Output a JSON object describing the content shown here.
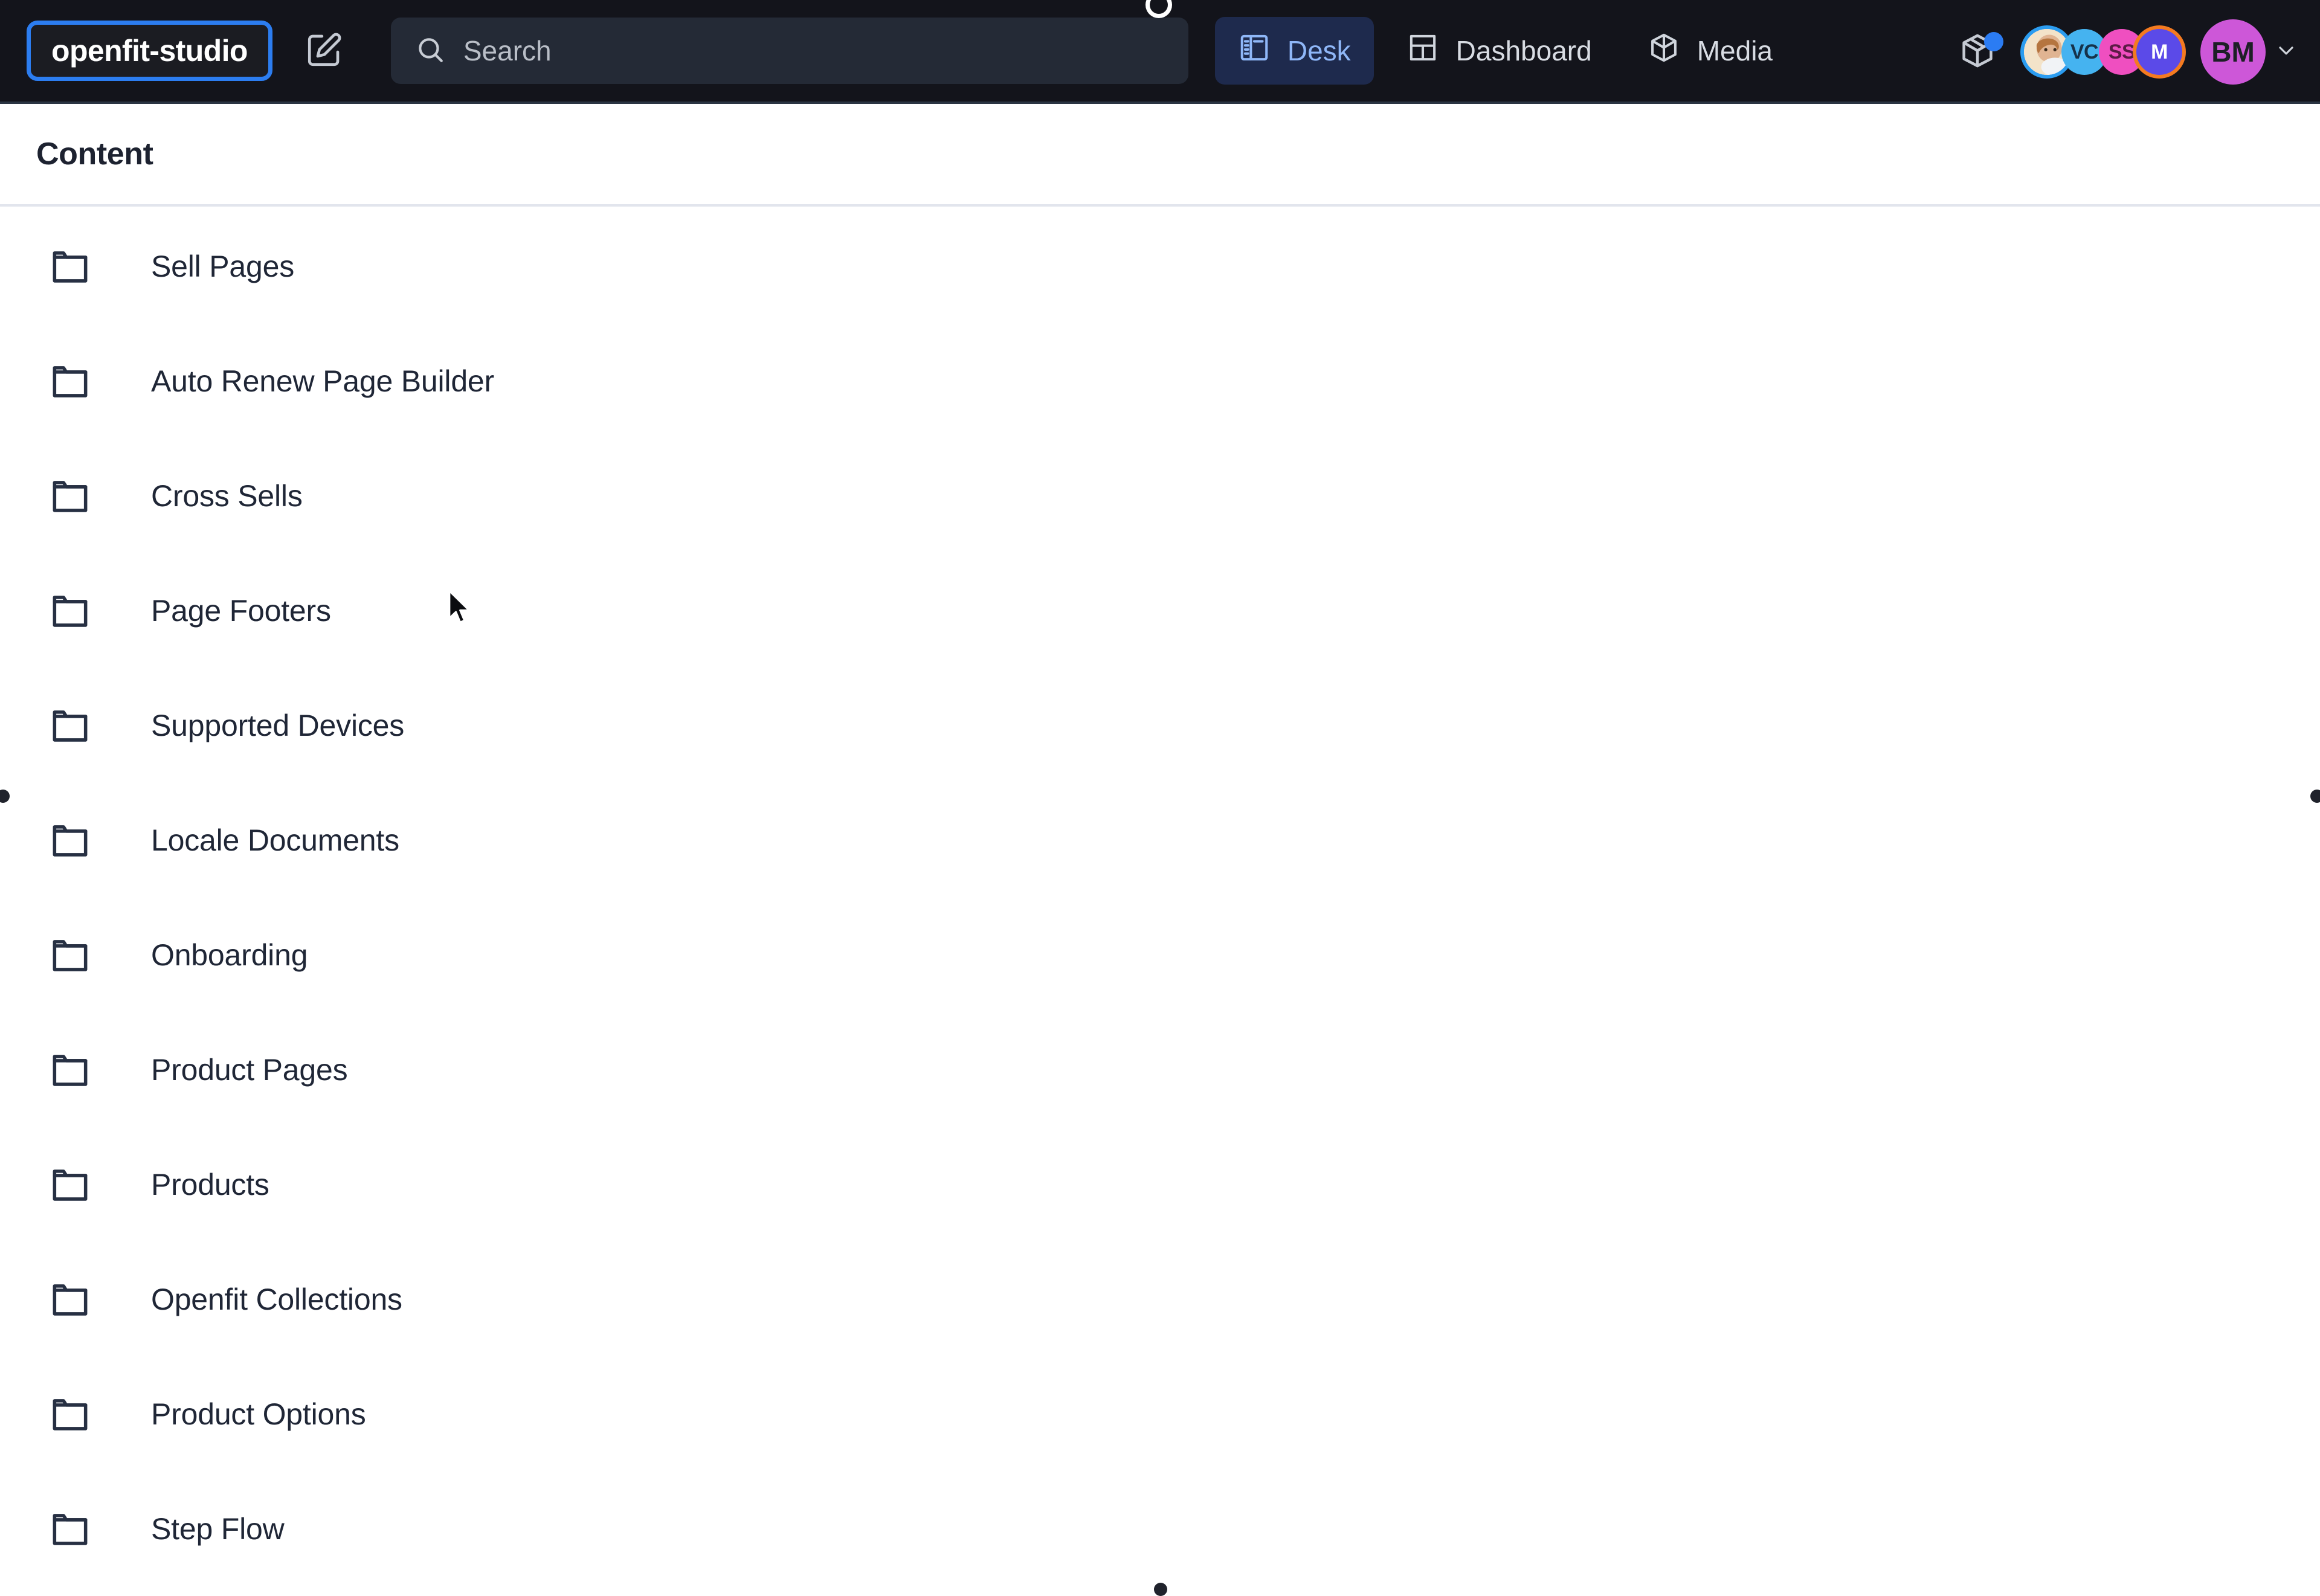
{
  "navbar": {
    "workspace_name": "openfit-studio",
    "compose_icon": "compose-edit-icon",
    "search": {
      "placeholder": "Search",
      "value": "",
      "icon": "search-icon"
    },
    "tabs": [
      {
        "label": "Desk",
        "icon": "desk-panels-icon",
        "active": true
      },
      {
        "label": "Dashboard",
        "icon": "dashboard-grid-icon",
        "active": false
      },
      {
        "label": "Media",
        "icon": "media-cube-icon",
        "active": false
      }
    ],
    "package_button": {
      "icon": "package-cube-icon",
      "badge": true,
      "badge_color": "#2b7cf3"
    },
    "presence_avatars": [
      {
        "type": "photo",
        "initials": "",
        "bg": "#f0dfc8",
        "ring": "#2b9cf0"
      },
      {
        "type": "initials",
        "initials": "VC",
        "bg": "#45b3f0",
        "ring": ""
      },
      {
        "type": "initials",
        "initials": "SS",
        "bg": "#ef4fc0",
        "ring": ""
      },
      {
        "type": "initials",
        "initials": "M",
        "bg": "#5b4ae8",
        "ring": "#f47a20"
      }
    ],
    "user_menu": {
      "initials": "BM",
      "bg": "#cd57d8",
      "chevron": "chevron-down-icon"
    },
    "colors": {
      "bar_bg": "#13141b",
      "active_tab_bg": "#1e2a4d",
      "active_tab_fg": "#8fb7f8",
      "focus_ring": "#2c7df0",
      "search_bg": "#242a36"
    }
  },
  "pane": {
    "title": "Content"
  },
  "list": {
    "items": [
      {
        "label": "Sell Pages",
        "icon": "folder-icon"
      },
      {
        "label": "Auto Renew Page Builder",
        "icon": "folder-icon"
      },
      {
        "label": "Cross Sells",
        "icon": "folder-icon"
      },
      {
        "label": "Page Footers",
        "icon": "folder-icon"
      },
      {
        "label": "Supported Devices",
        "icon": "folder-icon"
      },
      {
        "label": "Locale Documents",
        "icon": "folder-icon"
      },
      {
        "label": "Onboarding",
        "icon": "folder-icon"
      },
      {
        "label": "Product Pages",
        "icon": "folder-icon"
      },
      {
        "label": "Products",
        "icon": "folder-icon"
      },
      {
        "label": "Openfit Collections",
        "icon": "folder-icon"
      },
      {
        "label": "Product Options",
        "icon": "folder-icon"
      },
      {
        "label": "Step Flow",
        "icon": "folder-icon"
      }
    ]
  }
}
